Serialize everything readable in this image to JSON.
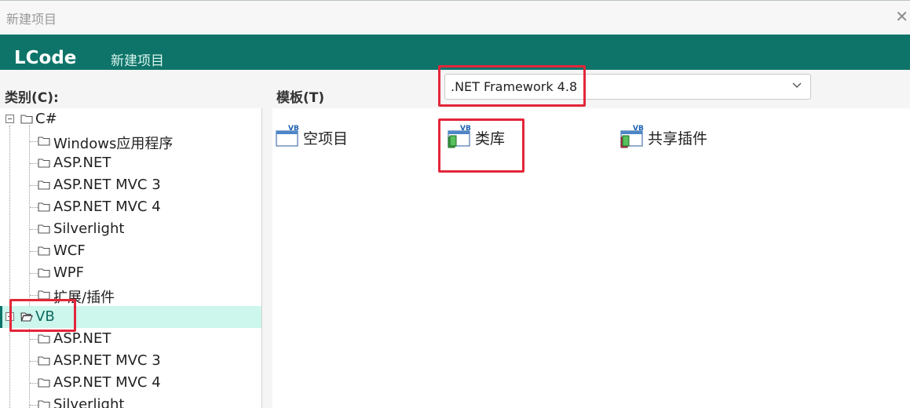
{
  "window": {
    "title": "新建项目",
    "close": "✕"
  },
  "brand": {
    "logo": "LCode",
    "tab": "新建项目"
  },
  "labels": {
    "category": "类别(C):",
    "template": "模板(T)"
  },
  "framework": {
    "selected": ".NET Framework 4.8"
  },
  "tree": {
    "csharp": "C#",
    "csharp_children": [
      "Windows应用程序",
      "ASP.NET",
      "ASP.NET MVC 3",
      "ASP.NET MVC 4",
      "Silverlight",
      "WCF",
      "WPF",
      "扩展/插件"
    ],
    "vb": "VB",
    "vb_children": [
      "ASP.NET",
      "ASP.NET MVC 3",
      "ASP.NET MVC 4",
      "Silverlight"
    ]
  },
  "templates": [
    {
      "label": "空项目",
      "icon": "vb-empty-project-icon"
    },
    {
      "label": "类库",
      "icon": "vb-class-library-icon"
    },
    {
      "label": "共享插件",
      "icon": "vb-shared-addin-icon"
    }
  ],
  "colors": {
    "brand": "#0e7469",
    "selected_row": "#cdf6ec",
    "highlight": "#e3263a"
  }
}
